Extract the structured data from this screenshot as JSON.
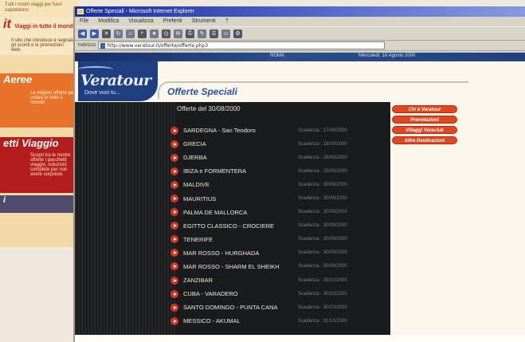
{
  "background_site": {
    "top_text": "Tutti i nostri viaggi per fuori capodanno",
    "promos": [
      {
        "title": "it",
        "subtitle": "Viaggi in tutto il mondo",
        "text": "Il sito che introduce e segnala gli sconti e le promozioni web."
      },
      {
        "title": "Aeree",
        "text": "Le migliori offerte per volare in tutto il mondo"
      },
      {
        "title": "etti Viaggio",
        "text": "Scopri tra le nostre offerte i pacchetti viaggio, soluzioni complete per non avere sorprese."
      },
      {
        "title": "i",
        "text": ""
      }
    ]
  },
  "browser": {
    "title": "Offerte Speciali - Microsoft Internet Explorer",
    "menu": [
      "File",
      "Modifica",
      "Visualizza",
      "Preferiti",
      "Strumenti",
      "?"
    ],
    "address_label": "Indirizzo",
    "url": "http://www.veratour.it/offerte/offerte.php3"
  },
  "page": {
    "banner": {
      "location": "ROMA",
      "date": "Mercoledì, 16 Agosto 2000"
    },
    "logo": {
      "brand": "Veratour",
      "tagline": "Dove vuoi tu..."
    },
    "section_title": "Offerte Speciali",
    "offers_date": "Offerte del 30/08/2000",
    "offers": [
      {
        "destination": "SARDEGNA - San Teodoro",
        "deadline": "Scadenza : 17/09/2000"
      },
      {
        "destination": "GRECIA",
        "deadline": "Scadenza : 18/09/2000"
      },
      {
        "destination": "DJERBA",
        "deadline": "Scadenza : 28/09/2000"
      },
      {
        "destination": "IBIZA e FORMENTERA",
        "deadline": "Scadenza : 29/09/2000"
      },
      {
        "destination": "MALDIVE",
        "deadline": "Scadenza : 30/09/2000"
      },
      {
        "destination": "MAURITIUS",
        "deadline": "Scadenza : 30/09/2000"
      },
      {
        "destination": "PALMA DE MALLORCA",
        "deadline": "Scadenza : 30/09/2000"
      },
      {
        "destination": "EGITTO CLASSICO - CROCIERE",
        "deadline": "Scadenza : 30/09/2000"
      },
      {
        "destination": "TENERIFE",
        "deadline": "Scadenza : 30/09/2000"
      },
      {
        "destination": "MAR ROSSO - HURGHADA",
        "deadline": "Scadenza : 30/09/2000"
      },
      {
        "destination": "MAR ROSSO - SHARM EL SHEIKH",
        "deadline": "Scadenza : 30/09/2000"
      },
      {
        "destination": "ZANZIBAR",
        "deadline": "Scadenza : 30/10/2000"
      },
      {
        "destination": "CUBA - VARADERO",
        "deadline": "Scadenza : 30/10/2000"
      },
      {
        "destination": "SANTO DOMINGO - PUNTA CANA",
        "deadline": "Scadenza : 30/10/2000"
      },
      {
        "destination": "MESSICO - AKUMAL",
        "deadline": "Scadenza : 31/10/2000"
      }
    ],
    "side_nav": [
      "Chi è Veratour",
      "Prenotazioni",
      "Villaggi Veraclub",
      "Altre Destinazioni"
    ]
  },
  "colors": {
    "accent": "#d8321f",
    "brand_blue": "#1f3f80",
    "title_blue": "#2a52a6",
    "panel": "#1a1b1c"
  }
}
